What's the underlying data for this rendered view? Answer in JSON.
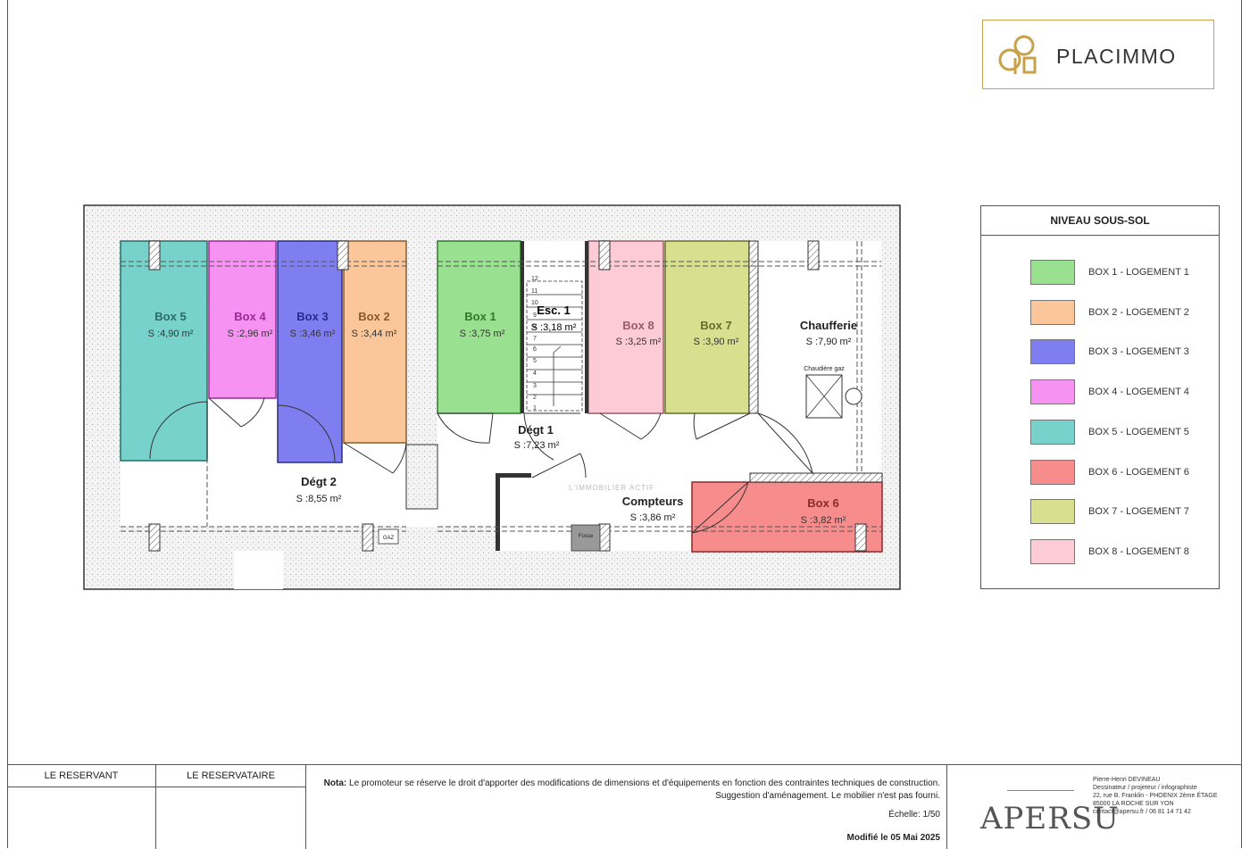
{
  "logo": {
    "name": "PLACIMMO"
  },
  "legend": {
    "title": "NIVEAU SOUS-SOL",
    "items": [
      {
        "label": "BOX 1 - LOGEMENT 1",
        "color": "#99e090"
      },
      {
        "label": "BOX 2 - LOGEMENT 2",
        "color": "#fbc79a"
      },
      {
        "label": "BOX 3 - LOGEMENT 3",
        "color": "#7f7ef0"
      },
      {
        "label": "BOX 4 - LOGEMENT 4",
        "color": "#f592f2"
      },
      {
        "label": "BOX 5 - LOGEMENT 5",
        "color": "#78d2cc"
      },
      {
        "label": "BOX 6 - LOGEMENT 6",
        "color": "#f78c8c"
      },
      {
        "label": "BOX 7 - LOGEMENT 7",
        "color": "#d8e090"
      },
      {
        "label": "BOX 8 - LOGEMENT 8",
        "color": "#fccbd6"
      }
    ]
  },
  "rooms": {
    "box5": {
      "name": "Box 5",
      "area": "S :4,90 m²",
      "color": "#78d2cc",
      "text_color": "#2a6b66"
    },
    "box4": {
      "name": "Box 4",
      "area": "S :2,96 m²",
      "color": "#f592f2",
      "text_color": "#9a2a95"
    },
    "box3": {
      "name": "Box 3",
      "area": "S :3,46 m²",
      "color": "#7f7ef0",
      "text_color": "#2a2a90"
    },
    "box2": {
      "name": "Box 2",
      "area": "S :3,44 m²",
      "color": "#fbc79a",
      "text_color": "#8a5a2a"
    },
    "box1": {
      "name": "Box 1",
      "area": "S :3,75 m²",
      "color": "#99e090",
      "text_color": "#2f7a2a"
    },
    "esc1": {
      "name": "Esc. 1",
      "area": "S :3,18 m²"
    },
    "box8": {
      "name": "Box 8",
      "area": "S :3,25 m²",
      "color": "#fccbd6",
      "text_color": "#9a5a6a"
    },
    "box7": {
      "name": "Box 7",
      "area": "S :3,90 m²",
      "color": "#d8e090",
      "text_color": "#6a6a2a"
    },
    "chaufferie": {
      "name": "Chaufferie",
      "area": "S :7,90 m²",
      "sub": "Chaudière gaz"
    },
    "degt1": {
      "name": "Dégt 1",
      "area": "S :7,23 m²"
    },
    "degt2": {
      "name": "Dégt 2",
      "area": "S :8,55 m²"
    },
    "compteurs": {
      "name": "Compteurs",
      "area": "S :3,86 m²"
    },
    "box6": {
      "name": "Box 6",
      "area": "S :3,82 m²",
      "color": "#f78c8c",
      "text_color": "#8a2a2a"
    },
    "gaz": "GAZ",
    "fosse": "Fosse",
    "watermark": "L'IMMOBILIER ACTIF",
    "steps": [
      "12",
      "11",
      "10",
      "9",
      "8",
      "7",
      "6",
      "5",
      "4",
      "3",
      "2",
      "1"
    ]
  },
  "footer": {
    "reservant": "LE RESERVANT",
    "reservataire": "LE RESERVATAIRE",
    "note_label": "Nota:",
    "note_text": "Le promoteur se réserve le droit d'apporter des modifications de dimensions et d'équipements en fonction des contraintes techniques de construction.",
    "note_line2": "Suggestion d'aménagement. Le mobilier n'est pas fourni.",
    "scale": "Échelle: 1/50",
    "modified": "Modifié le 05 Mai 2025",
    "firm": "APERSU",
    "contact_lines": [
      "Pierre-Henri DEVINEAU",
      "Dessinateur / projeteur / infographiste",
      "22, rue B. Franklin - PHOENIX 2ème ÉTAGE",
      "85000 LA ROCHE SUR YON",
      "contact@apersu.fr  /  06 81 14 71 42"
    ]
  }
}
